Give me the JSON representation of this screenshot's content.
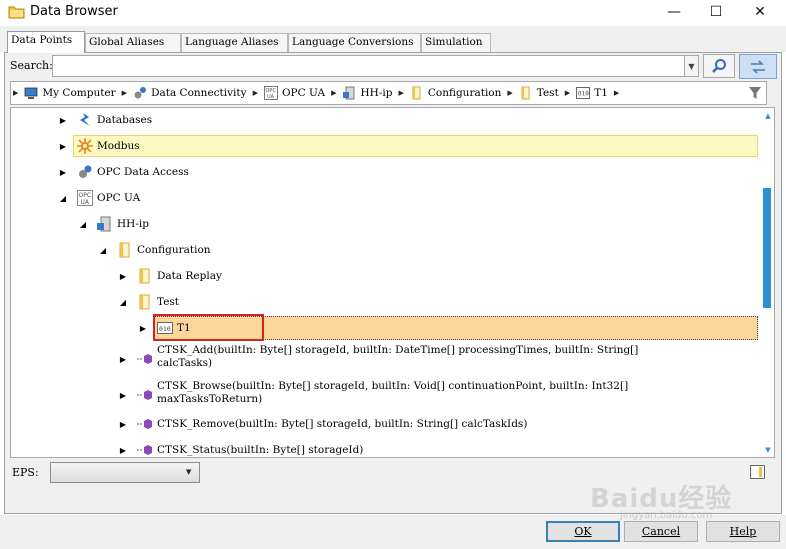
{
  "window": {
    "title": "Data Browser",
    "minimize_glyph": "—",
    "maximize_glyph": "☐",
    "close_glyph": "✕"
  },
  "tabs": [
    {
      "label": "Data Points",
      "active": true
    },
    {
      "label": "Global Aliases",
      "active": false
    },
    {
      "label": "Language Aliases",
      "active": false
    },
    {
      "label": "Language Conversions",
      "active": false
    },
    {
      "label": "Simulation",
      "active": false
    }
  ],
  "search": {
    "label": "Search:",
    "value": "",
    "go_icon": "search-icon",
    "swap_icon": "swap-arrows-icon"
  },
  "breadcrumb": [
    {
      "label": "My Computer",
      "icon": "computer-icon"
    },
    {
      "label": "Data Connectivity",
      "icon": "gears-icon"
    },
    {
      "label": "OPC UA",
      "icon": "opc-ua-icon"
    },
    {
      "label": "HH-ip",
      "icon": "server-icon"
    },
    {
      "label": "Configuration",
      "icon": "folder-icon"
    },
    {
      "label": "Test",
      "icon": "folder-icon"
    },
    {
      "label": "T1",
      "icon": "object-icon"
    }
  ],
  "tree": [
    {
      "label": "Databases",
      "expander": "▶",
      "icon": "databases-icon"
    },
    {
      "label": "Modbus",
      "expander": "▶",
      "icon": "modbus-icon",
      "highlighted": true
    },
    {
      "label": "OPC Data Access",
      "expander": "▶",
      "icon": "gears-icon"
    },
    {
      "label": "OPC UA",
      "expander": "◢",
      "icon": "opc-ua-icon"
    },
    {
      "label": "HH-ip",
      "expander": "◢",
      "icon": "server-icon"
    },
    {
      "label": "Configuration",
      "expander": "◢",
      "icon": "folder-icon"
    },
    {
      "label": "Data Replay",
      "expander": "▶",
      "icon": "folder-icon"
    },
    {
      "label": "Test",
      "expander": "◢",
      "icon": "folder-icon"
    },
    {
      "label": "T1",
      "expander": "▶",
      "icon": "object-icon",
      "selected": true
    },
    {
      "label": "CTSK_Add(builtIn: Byte[] storageId, builtIn: DateTime[] processingTimes, builtIn: String[]",
      "label2": "calcTasks)",
      "expander": "▶",
      "icon": "method-icon"
    },
    {
      "label": "CTSK_Browse(builtIn: Byte[] storageId, builtIn: Void[] continuationPoint, builtIn: Int32[]",
      "label2": "maxTasksToReturn)",
      "expander": "▶",
      "icon": "method-icon"
    },
    {
      "label": "CTSK_Remove(builtIn: Byte[] storageId, builtIn: String[] calcTaskIds)",
      "expander": "▶",
      "icon": "method-icon"
    },
    {
      "label": "CTSK_Status(builtIn: Byte[] storageId)",
      "expander": "▶",
      "icon": "method-icon"
    }
  ],
  "eps": {
    "label": "EPS:",
    "value": ""
  },
  "buttons": {
    "ok": "OK",
    "cancel": "Cancel",
    "help": "Help"
  },
  "watermark": "Baidu经验",
  "watermark_url": "jingyan.baidu.com",
  "colors": {
    "modbus_highlight": "#fdf7c2",
    "selected_row": "#fcd59a",
    "red_box": "#d32424",
    "scroll_thumb": "#2b8fd0"
  }
}
